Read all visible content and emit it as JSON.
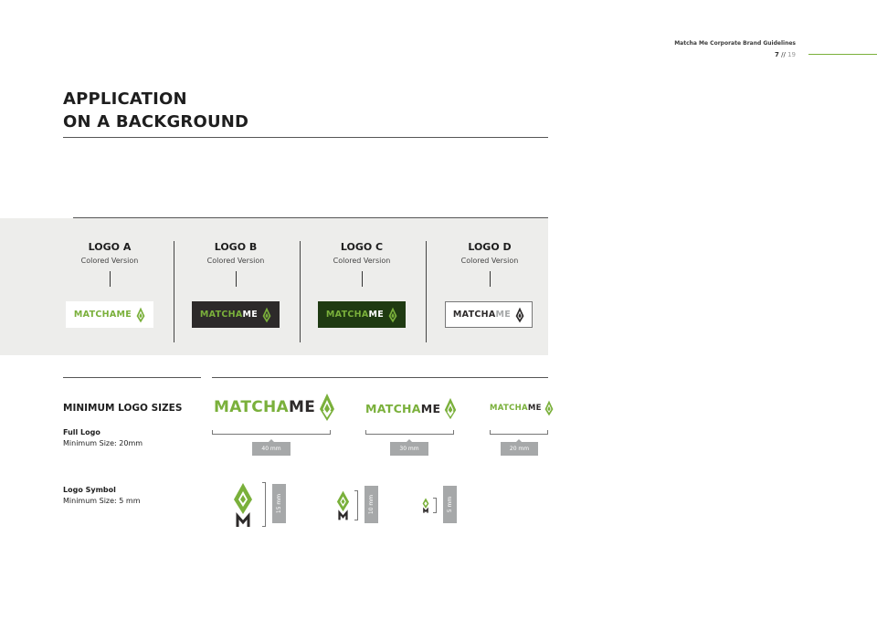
{
  "header": {
    "doc_title": "Matcha Me Corporate Brand Guidelines",
    "page_current": "7",
    "page_sep": " // ",
    "page_total": "19"
  },
  "section": {
    "title_line1": "APPLICATION",
    "title_line2": "ON A BACKGROUND"
  },
  "logos": [
    {
      "name": "LOGO A",
      "sub": "Colored Version",
      "bg": "#ffffff",
      "border": "none",
      "left_color": "#7ab03b",
      "right_color": "#7ab03b",
      "icon_color": "#7ab03b"
    },
    {
      "name": "LOGO B",
      "sub": "Colored Version",
      "bg": "#2d2a2a",
      "border": "none",
      "left_color": "#7ab03b",
      "right_color": "#ffffff",
      "icon_color": "#7ab03b"
    },
    {
      "name": "LOGO C",
      "sub": "Colored Version",
      "bg": "#1f3a12",
      "border": "none",
      "left_color": "#7ab03b",
      "right_color": "#ffffff",
      "icon_color": "#7ab03b"
    },
    {
      "name": "LOGO D",
      "sub": "Colored Version",
      "bg": "#ffffff",
      "border": "#777777",
      "left_color": "#2d2a2a",
      "right_color": "#a6a8a9",
      "icon_color": "#2d2a2a"
    }
  ],
  "wordmark": {
    "left": "MATCHA",
    "right": "ME"
  },
  "min_sizes": {
    "title": "MINIMUM LOGO SIZES",
    "full_logo_label": "Full Logo",
    "full_logo_min": "Minimum Size: 20mm",
    "symbol_label": "Logo Symbol",
    "symbol_min": "Minimum Size: 5 mm",
    "full_sizes": [
      "40 mm",
      "30 mm",
      "20 mm"
    ],
    "symbol_sizes": [
      "15 mm",
      "10 mm",
      "5 mm"
    ]
  },
  "colors": {
    "green": "#7ab03b",
    "dark": "#2d2a2a",
    "grey": "#a6a8a9",
    "band": "#ededeb"
  }
}
